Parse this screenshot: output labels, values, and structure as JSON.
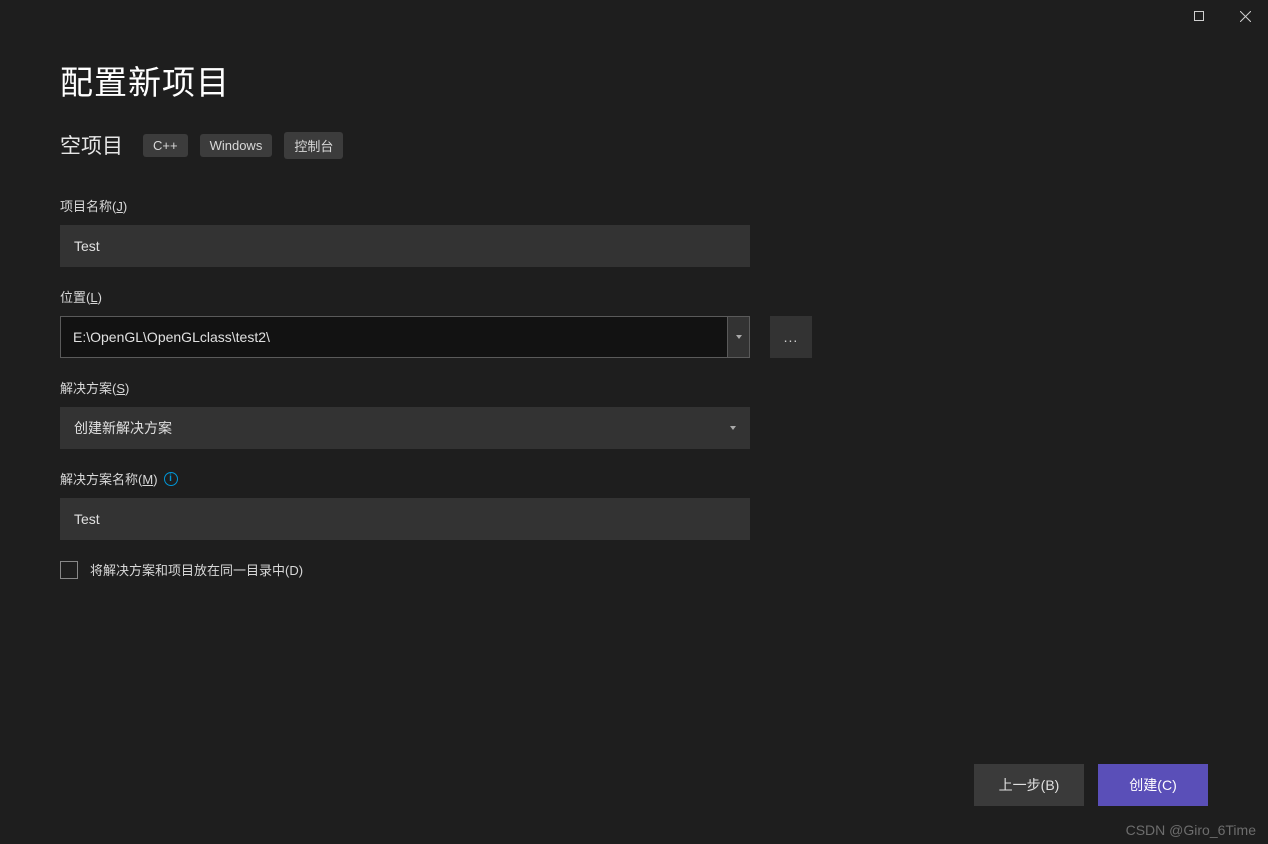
{
  "window": {
    "title": "配置新项目",
    "maximize_label": "maximize",
    "close_label": "close"
  },
  "template": {
    "name": "空项目",
    "tags": [
      "C++",
      "Windows",
      "控制台"
    ]
  },
  "form": {
    "project_name": {
      "label": "项目名称(",
      "hotkey": "J",
      "suffix": ")",
      "value": "Test"
    },
    "location": {
      "label": "位置(",
      "hotkey": "L",
      "suffix": ")",
      "value": "E:\\OpenGL\\OpenGLclass\\test2\\"
    },
    "browse_label": "...",
    "solution": {
      "label": "解决方案(",
      "hotkey": "S",
      "suffix": ")",
      "value": "创建新解决方案"
    },
    "solution_name": {
      "label": "解决方案名称(",
      "hotkey": "M",
      "suffix": ")",
      "value": "Test"
    },
    "same_dir": {
      "label": "将解决方案和项目放在同一目录中(",
      "hotkey": "D",
      "suffix": ")",
      "checked": false
    }
  },
  "footer": {
    "back": {
      "label": "上一步(",
      "hotkey": "B",
      "suffix": ")"
    },
    "create": {
      "label": "创建(",
      "hotkey": "C",
      "suffix": ")"
    }
  },
  "watermark": "CSDN @Giro_6Time"
}
